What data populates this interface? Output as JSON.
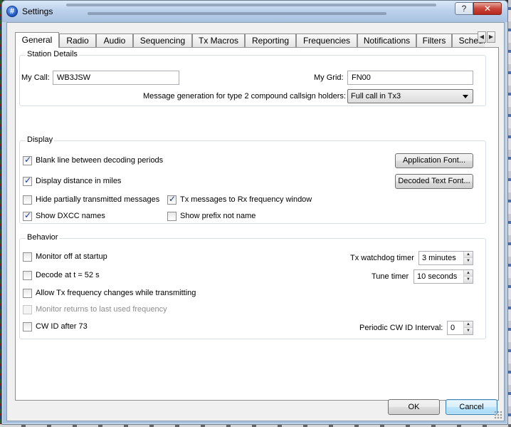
{
  "window": {
    "title": "Settings",
    "help_label": "?",
    "close_label": "✕"
  },
  "tabs": [
    {
      "label": "General"
    },
    {
      "label": "Radio"
    },
    {
      "label": "Audio"
    },
    {
      "label": "Sequencing"
    },
    {
      "label": "Tx Macros"
    },
    {
      "label": "Reporting"
    },
    {
      "label": "Frequencies"
    },
    {
      "label": "Notifications"
    },
    {
      "label": "Filters"
    },
    {
      "label": "Schedu"
    }
  ],
  "station": {
    "title": "Station Details",
    "my_call_label": "My Call:",
    "my_call_value": "WB3JSW",
    "my_grid_label": "My Grid:",
    "my_grid_value": "FN00",
    "message_gen_label": "Message generation for type 2 compound callsign holders:",
    "message_gen_value": "Full call in Tx3"
  },
  "display": {
    "title": "Display",
    "blank_line": {
      "label": "Blank line between decoding periods",
      "checked": true
    },
    "distance_miles": {
      "label": "Display distance in miles",
      "checked": true
    },
    "hide_partial": {
      "label": "Hide partially transmitted messages",
      "checked": false
    },
    "tx_to_rx": {
      "label": "Tx messages to Rx frequency window",
      "checked": true
    },
    "show_dxcc": {
      "label": "Show DXCC names",
      "checked": true
    },
    "show_prefix": {
      "label": "Show prefix not name",
      "checked": false
    },
    "app_font_label": "Application Font...",
    "decoded_font_label": "Decoded Text Font..."
  },
  "behavior": {
    "title": "Behavior",
    "monitor_off": {
      "label": "Monitor off at startup",
      "checked": false
    },
    "decode_52": {
      "label": "Decode at t = 52 s",
      "checked": false
    },
    "allow_tx_change": {
      "label": "Allow Tx frequency changes while transmitting",
      "checked": false
    },
    "monitor_returns": {
      "label": "Monitor returns to last used frequency",
      "checked": false
    },
    "cw_id": {
      "label": "CW ID after 73",
      "checked": false
    },
    "watchdog_label": "Tx watchdog timer",
    "watchdog_value": "3 minutes",
    "tune_label": "Tune timer",
    "tune_value": "10 seconds",
    "cw_interval_label": "Periodic CW ID Interval:",
    "cw_interval_value": "0"
  },
  "footer": {
    "ok_label": "OK",
    "cancel_label": "Cancel"
  }
}
